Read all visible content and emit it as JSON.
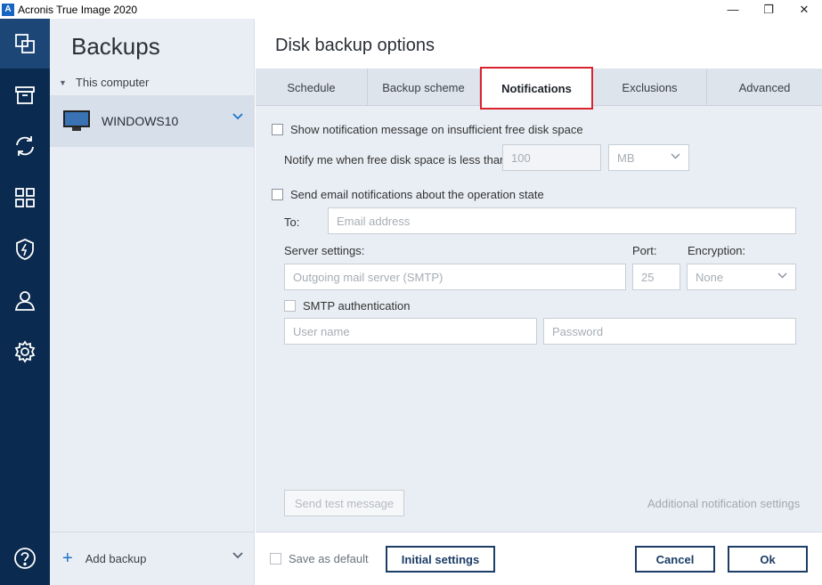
{
  "window": {
    "app_logo_letter": "A",
    "title": "Acronis True Image 2020",
    "controls": {
      "minimize": "—",
      "restore": "❐",
      "close": "✕"
    }
  },
  "nav": {
    "items": [
      "backup-icon",
      "archive-icon",
      "sync-icon",
      "dashboard-icon",
      "protection-icon",
      "account-icon",
      "settings-icon",
      "help-icon"
    ],
    "active_index": 0
  },
  "backups": {
    "title": "Backups",
    "group_label": "This computer",
    "computer_name": "WINDOWS10",
    "add_backup_label": "Add backup"
  },
  "main": {
    "title": "Disk backup options",
    "tabs": [
      {
        "label": "Schedule"
      },
      {
        "label": "Backup scheme"
      },
      {
        "label": "Notifications"
      },
      {
        "label": "Exclusions"
      },
      {
        "label": "Advanced"
      }
    ],
    "active_tab": "Notifications"
  },
  "notifications": {
    "insufficient_space_label": "Show notification message on insufficient free disk space",
    "threshold_label": "Notify me when free disk space is less than:",
    "threshold_value": "100",
    "threshold_unit": "MB",
    "email_label": "Send email notifications about the operation state",
    "to_label": "To:",
    "to_placeholder": "Email address",
    "server_settings_label": "Server settings:",
    "server_placeholder": "Outgoing mail server (SMTP)",
    "port_label": "Port:",
    "port_value": "25",
    "encryption_label": "Encryption:",
    "encryption_value": "None",
    "smtp_auth_label": "SMTP authentication",
    "username_placeholder": "User name",
    "password_placeholder": "Password",
    "send_test_label": "Send test message",
    "additional_settings_label": "Additional notification settings"
  },
  "footer": {
    "save_default_label": "Save as default",
    "initial_settings_label": "Initial settings",
    "cancel_label": "Cancel",
    "ok_label": "Ok"
  },
  "colors": {
    "nav_bg": "#0b2a4f",
    "accent": "#1e74c6",
    "active_tab_border": "#d9232e",
    "button_border": "#1b3d66"
  }
}
